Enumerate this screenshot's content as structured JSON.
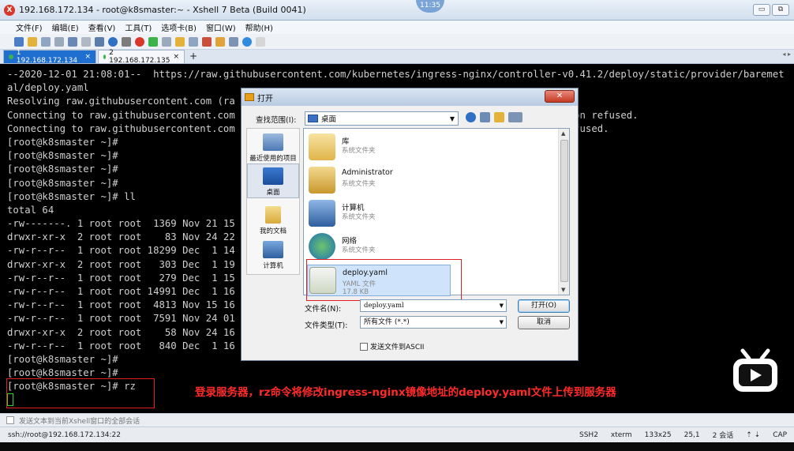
{
  "window": {
    "title": "192.168.172.134 - root@k8smaster:~ - Xshell 7 Beta (Build 0041)",
    "clock": "11:35",
    "buttons": [
      "▭",
      "⧉"
    ]
  },
  "menu": [
    "文件(F)",
    "编辑(E)",
    "查看(V)",
    "工具(T)",
    "选项卡(B)",
    "窗口(W)",
    "帮助(H)"
  ],
  "tabs": [
    {
      "label": "1 192.168.172.134",
      "close": "×",
      "active": true
    },
    {
      "label": "2 192.168.172.135",
      "close": "×",
      "active": false
    }
  ],
  "add_tab": "+",
  "terminal": {
    "lines": [
      "--2020-12-01 21:08:01--  https://raw.githubusercontent.com/kubernetes/ingress-nginx/controller-v0.41.2/deploy/static/provider/baremet",
      "al/deploy.yaml",
      "Resolving raw.githubusercontent.com (ra",
      "Connecting to raw.githubusercontent.com                                                      ection refused.",
      "Connecting to raw.githubusercontent.com                                                      n refused.",
      "[root@k8smaster ~]#",
      "[root@k8smaster ~]#",
      "[root@k8smaster ~]#",
      "[root@k8smaster ~]#",
      "[root@k8smaster ~]# ll",
      "total 64",
      "-rw-------. 1 root root  1369 Nov 21 15",
      "drwxr-xr-x  2 root root    83 Nov 24 22",
      "-rw-r--r--  1 root root 18299 Dec  1 14",
      "drwxr-xr-x  2 root root   303 Dec  1 19",
      "-rw-r--r--  1 root root   279 Dec  1 15",
      "-rw-r--r--  1 root root 14991 Dec  1 16",
      "-rw-r--r--  1 root root  4813 Nov 15 16",
      "-rw-r--r--  1 root root  7591 Nov 24 01",
      "drwxr-xr-x  2 root root    58 Nov 24 16",
      "-rw-r--r--  1 root root   840 Dec  1 16",
      "[root@k8smaster ~]#",
      "[root@k8smaster ~]#",
      "[root@k8smaster ~]# rz"
    ]
  },
  "annotation": "登录服务器，rz命令将修改ingress-nginx镜像地址的deploy.yaml文件上传到服务器",
  "sendbar": "发送文本到当前Xshell窗口的全部会话",
  "status": {
    "connection": "ssh://root@192.168.172.134:22",
    "protocol": "SSH2",
    "term": "xterm",
    "size": "133x25",
    "pos": "25,1",
    "sessions": "2 会话",
    "caps": "CAP"
  },
  "dialog": {
    "title": "打开",
    "close": "✕",
    "lookin_label": "查找范围(I):",
    "lookin_value": "桌面",
    "places": [
      "最近使用的项目",
      "桌面",
      "我的文档",
      "计算机"
    ],
    "files": [
      {
        "name": "库",
        "sub": "系统文件夹",
        "sub2": ""
      },
      {
        "name": "Administrator",
        "sub": "系统文件夹",
        "sub2": ""
      },
      {
        "name": "计算机",
        "sub": "系统文件夹",
        "sub2": ""
      },
      {
        "name": "网络",
        "sub": "系统文件夹",
        "sub2": ""
      },
      {
        "name": "deploy.yaml",
        "sub": "YAML 文件",
        "sub2": "17.8 KB"
      }
    ],
    "filename_label": "文件名(N):",
    "filename_value": "deploy.yaml",
    "filetype_label": "文件类型(T):",
    "filetype_value": "所有文件 (*.*)",
    "open_button": "打开(O)",
    "cancel_button": "取消",
    "ascii_label": "发送文件到ASCII"
  },
  "colors": {
    "terminal_bg": "#000000",
    "terminal_fg": "#d0d0d0",
    "annotation": "#ff2a2a",
    "highlight_box": "#e02020",
    "active_tab": "#1e6fd0"
  }
}
